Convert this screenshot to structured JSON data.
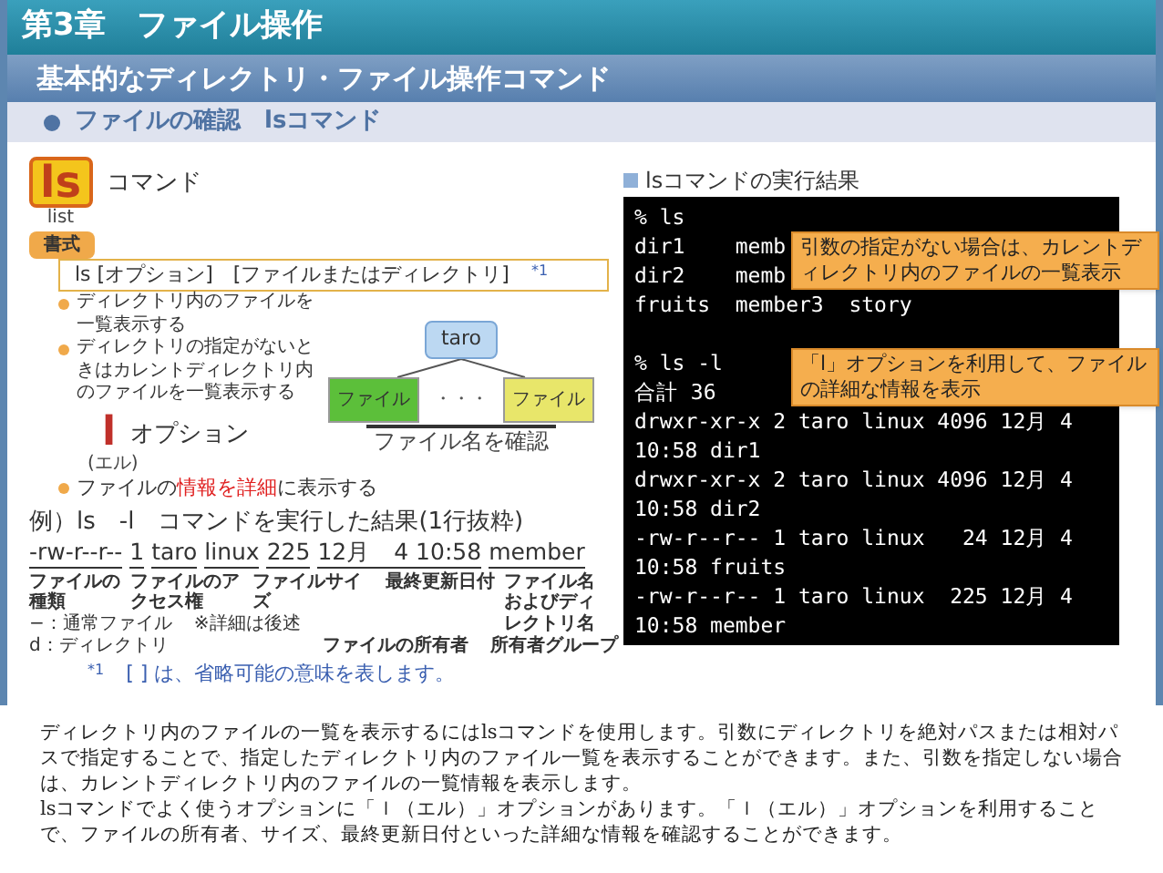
{
  "chapter_title": "第3章　ファイル操作",
  "slide_title": "基本的なディレクトリ・ファイル操作コマンド",
  "section_title": "ファイルの確認　lsコマンド",
  "command": {
    "name": "ls",
    "label": "コマンド",
    "meaning": "list"
  },
  "format": {
    "tag": "書式",
    "syntax": "ls [オプション]　[ファイルまたはディレクトリ]",
    "note_mark": "*1"
  },
  "bullets": [
    "ディレクトリ内のファイルを一覧表示する",
    "ディレクトリの指定がないときはカレントディレクトリ内のファイルを一覧表示する"
  ],
  "tree": {
    "root": "taro",
    "files": [
      {
        "label": "ファイル",
        "color": "#5cbf3a"
      },
      {
        "label": "ファイル",
        "color": "#e8e66a"
      }
    ],
    "dots": "・・・",
    "caption": "ファイル名を確認"
  },
  "option": {
    "letter": "l",
    "label": "オプション",
    "reading": "(エル)",
    "description": {
      "before": "ファイルの",
      "highlight": "情報を詳細",
      "after": "に表示する"
    }
  },
  "example": {
    "heading": "例）ls　-l　コマンドを実行した結果(1行抜粋)",
    "fields": [
      "-rw-r--r--",
      "1",
      "taro",
      "linux",
      "225",
      "12月　4 10:58",
      "member"
    ],
    "annotations": [
      {
        "label": "ファイルの種類",
        "notes": [
          "−：通常ファイル",
          "d：ディレクトリ"
        ]
      },
      {
        "label": "ファイルのアクセス権",
        "notes": [
          "※詳細は後述"
        ]
      },
      {
        "label": "ファイルサイズ"
      },
      {
        "label": "最終更新日付"
      },
      {
        "label": "ファイル名およびディレクトリ名"
      },
      {
        "label": "ファイルの所有者"
      },
      {
        "label": "所有者グループ"
      }
    ]
  },
  "footnote": {
    "mark": "*1",
    "text": "[ ] は、省略可能の意味を表します。"
  },
  "result": {
    "title": "lsコマンドの実行結果",
    "terminal_blocks": [
      [
        "% ls",
        "dir1    memb",
        "dir2    memb",
        "fruits  member3  story"
      ],
      [
        "% ls -l",
        "合計 36",
        "drwxr-xr-x 2 taro linux 4096 12月 4",
        "10:58 dir1",
        "drwxr-xr-x 2 taro linux 4096 12月 4",
        "10:58 dir2",
        "-rw-r--r-- 1 taro linux   24 12月 4",
        "10:58 fruits",
        "-rw-r--r-- 1 taro linux  225 12月 4",
        "10:58 member"
      ]
    ],
    "callouts": [
      "引数の指定がない場合は、カレントディレクトリ内のファイルの一覧表示",
      "「l」オプションを利用して、ファイルの詳細な情報を表示"
    ]
  },
  "description": [
    "ディレクトリ内のファイルの一覧を表示するにはlsコマンドを使用します。引数にディレクトリを絶対パスまたは相対パスで指定することで、指定したディレクトリ内のファイル一覧を表示することができます。また、引数を指定しない場合は、カレントディレクトリ内のファイルの一覧情報を表示します。",
    "lsコマンドでよく使うオプションに「ｌ（エル）」オプションがあります。「ｌ（エル）」オプションを利用することで、ファイルの所有者、サイズ、最終更新日付といった詳細な情報を確認することができます。"
  ]
}
